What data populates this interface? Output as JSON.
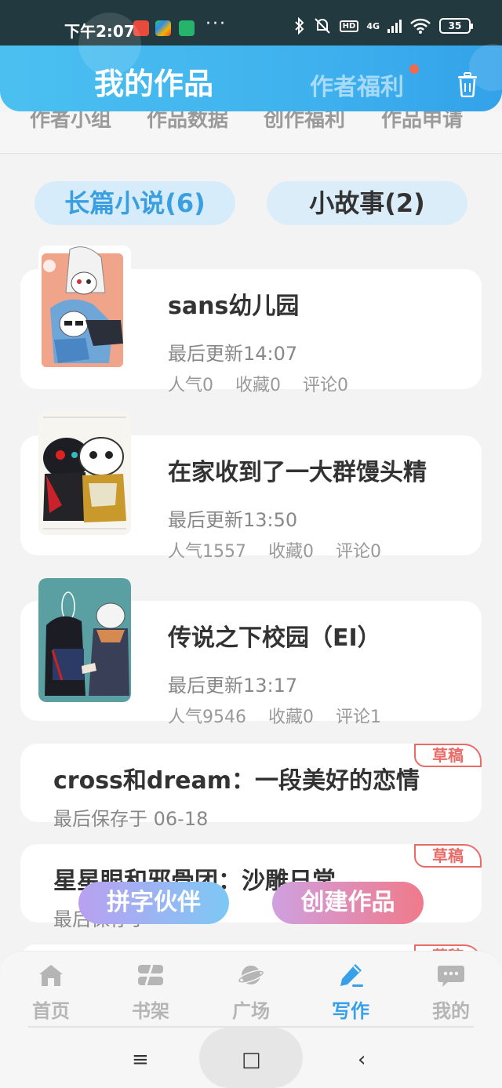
{
  "status_bar": {
    "time": "下午2:07",
    "more": "···",
    "hd": "HD",
    "network": "4G",
    "battery": "35"
  },
  "header": {
    "title": "我的作品",
    "benefit_label": "作者福利",
    "trash_icon": "trash-icon"
  },
  "sub_tabs": [
    "作者小组",
    "作品数据",
    "创作福利",
    "作品申请"
  ],
  "categories": {
    "novel": "长篇小说(6)",
    "story": "小故事(2)"
  },
  "works": [
    {
      "title": "sans幼儿园",
      "updated": "最后更新14:07",
      "popularity": "人气0",
      "favorites": "收藏0",
      "comments": "评论0"
    },
    {
      "title": "在家收到了一大群馒头精",
      "updated": "最后更新13:50",
      "popularity": "人气1557",
      "favorites": "收藏0",
      "comments": "评论0"
    },
    {
      "title": "传说之下校园（EI）",
      "updated": "最后更新13:17",
      "popularity": "人气9546",
      "favorites": "收藏0",
      "comments": "评论1"
    }
  ],
  "drafts": [
    {
      "title": "cross和dream：一段美好的恋情",
      "saved": "最后保存于 06-18",
      "tag": "草稿"
    },
    {
      "title": "星星眼和邪骨团：沙雕日常",
      "saved": "最后保存于",
      "tag": "草稿"
    },
    {
      "tag": "草稿"
    }
  ],
  "floating": {
    "partner": "拼字伙伴",
    "create": "创建作品"
  },
  "bottom_nav": [
    {
      "label": "首页",
      "icon": "home-icon"
    },
    {
      "label": "书架",
      "icon": "bookshelf-icon"
    },
    {
      "label": "广场",
      "icon": "planet-icon"
    },
    {
      "label": "写作",
      "icon": "pen-icon",
      "active": true
    },
    {
      "label": "我的",
      "icon": "chat-bubble-icon"
    }
  ],
  "system_nav": {
    "menu": "≡",
    "home": "□",
    "back": "‹"
  },
  "colors": {
    "accent": "#38a0e8",
    "header_start": "#4bc0f0",
    "draft_tag": "#e96b67"
  }
}
